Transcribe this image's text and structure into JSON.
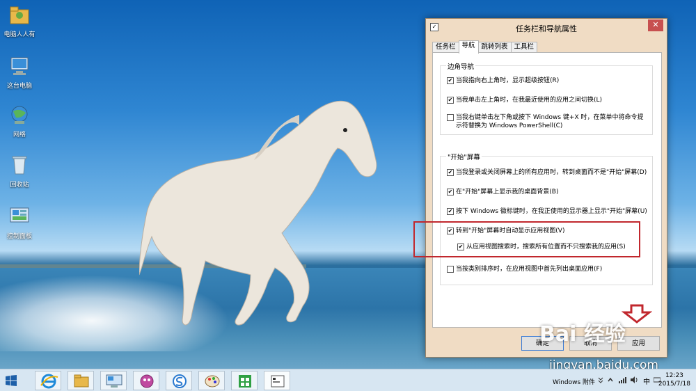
{
  "desktop": {
    "icons": [
      {
        "label": "电脑人人有",
        "icon": "folder-icon"
      },
      {
        "label": "这台电脑",
        "icon": "computer-icon"
      },
      {
        "label": "网络",
        "icon": "network-icon"
      },
      {
        "label": "回收站",
        "icon": "recycle-bin-icon"
      },
      {
        "label": "控制面板",
        "icon": "control-panel-icon"
      }
    ]
  },
  "dialog": {
    "title": "任务栏和导航属性",
    "close_label": "✕",
    "tabs": [
      "任务栏",
      "导航",
      "跳转列表",
      "工具栏"
    ],
    "active_tab": "导航",
    "corner_group": {
      "label": "边角导航",
      "options": [
        {
          "label": "当我指向右上角时，显示超级按钮(R)",
          "checked": true
        },
        {
          "label": "当我单击左上角时，在我最近使用的应用之间切换(L)",
          "checked": true
        },
        {
          "label": "当我右键单击左下角或按下 Windows 键+X 时，在菜单中将命令提示符替换为 Windows PowerShell(C)",
          "checked": false
        }
      ]
    },
    "start_group": {
      "label": "\"开始\"屏幕",
      "options": [
        {
          "label": "当我登录或关闭屏幕上的所有应用时，转到桌面而不是\"开始\"屏幕(D)",
          "checked": true
        },
        {
          "label": "在\"开始\"屏幕上显示我的桌面背景(B)",
          "checked": true
        },
        {
          "label": "按下 Windows 徽标键时，在我正使用的显示器上显示\"开始\"屏幕(U)",
          "checked": true
        },
        {
          "label": "转到\"开始\"屏幕时自动显示应用视图(V)",
          "checked": true
        },
        {
          "label": "从应用视图搜索时，搜索所有位置而不只搜索我的应用(S)",
          "checked": true
        },
        {
          "label": "当按类别排序时，在应用视图中首先列出桌面应用(F)",
          "checked": false
        }
      ]
    },
    "buttons": {
      "ok": "确定",
      "cancel": "取消",
      "apply": "应用"
    }
  },
  "watermark": {
    "text": "jingyan.baidu.com",
    "logo": "Bai 经验"
  },
  "taskbar": {
    "toolbar_label": "Windows 附件",
    "clock_time": "12:23",
    "clock_date": "2015/7/18",
    "ime": "中",
    "apps": [
      "ie-icon",
      "file-explorer-icon",
      "remote-desktop-icon",
      "media-icon",
      "sogou-icon",
      "paint-icon",
      "store-icon",
      "settings-window-icon"
    ]
  },
  "colors": {
    "highlight": "#c1272d",
    "dialog_frame": "#f0dcc4",
    "taskbar": "#d7e6f2"
  }
}
